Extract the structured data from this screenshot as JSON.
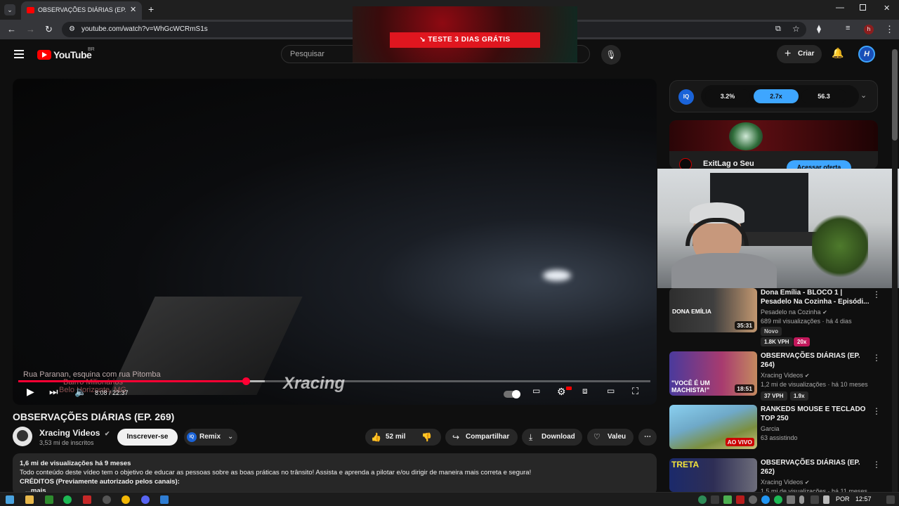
{
  "browser": {
    "tab_title": "OBSERVAÇÕES DIÁRIAS (EP. 269)",
    "tab_close": "✕",
    "new_tab": "+",
    "url": "youtube.com/watch?v=WhGcWCRmS1s",
    "profile_initial": "h"
  },
  "header": {
    "logo_text": "YouTube",
    "logo_country": "BR",
    "search_placeholder": "Pesquisar",
    "create_label": "Criar",
    "ad_cta": "↘ TESTE 3 DIAS GRÁTIS"
  },
  "player": {
    "overlay_street": "Rua Paranan, esquina com rua Pitomba",
    "overlay_neighborhood": "Bairro Milionários",
    "overlay_city": "Belo Horizonte, MG",
    "current_time": "8:08",
    "duration": "22:37",
    "time_display": "8:08 / 22:37",
    "watermark": "Xracing",
    "progress_fraction": 0.36,
    "buffered_fraction": 0.39
  },
  "video": {
    "title": "OBSERVAÇÕES DIÁRIAS (EP. 269)",
    "channel": "Xracing Videos",
    "subscribers": "3,53 mi de inscritos",
    "subscribe_label": "Inscrever-se",
    "remix_label": "Remix",
    "likes": "52 mil",
    "share_label": "Compartilhar",
    "download_label": "Download",
    "thanks_label": "Valeu",
    "views_date": "1,6 mi de visualizações  há 9 meses",
    "description": "Todo conteúdo deste vídeo tem o objetivo de educar as pessoas sobre as boas práticas no trânsito! Assista e aprenda a pilotar e/ou dirigir de maneira mais correta e segura!",
    "credits": "CRÉDITOS (Previamente autorizado pelos canais):",
    "more": "...mais"
  },
  "iq_widget": {
    "logo": "IQ",
    "values": [
      "3.2%",
      "2.7x",
      "56.3"
    ]
  },
  "sponsor": {
    "title": "ExitLag o Seu",
    "cta": "Acessar oferta"
  },
  "recommendations": [
    {
      "title": "Dona Emília  - BLOCO 1 | Pesadelo Na Cozinha - Episódi...",
      "channel": "Pesadelo na Cozinha",
      "meta": "689 mil visualizações · há 4 dias",
      "duration": "35:31",
      "badge_new": "Novo",
      "vph": "1.8K VPH",
      "mult": "20x",
      "thumb_text": "DONA EMÍLIA"
    },
    {
      "title": "OBSERVAÇÕES DIÁRIAS (EP. 264)",
      "channel": "Xracing Videos",
      "meta": "1,2 mi de visualizações · há 10 meses",
      "duration": "18:51",
      "vph": "37 VPH",
      "mult": "1.9x",
      "thumb_text": "\"VOCÊ É UM MACHISTA!\""
    },
    {
      "title": "RANKEDS MOUSE E TECLADO TOP 250",
      "channel": "Garcia",
      "meta": "63 assistindo",
      "live": "AO VIVO"
    },
    {
      "title": "OBSERVAÇÕES DIÁRIAS (EP. 262)",
      "channel": "Xracing Videos",
      "meta": "1,5 mi de visualizações · há 11 meses",
      "thumb_text": "TRETA"
    }
  ],
  "taskbar": {
    "lang": "POR",
    "clock": "12:57"
  },
  "colors": {
    "accent_red": "#ff0033",
    "iq_blue": "#3ea6ff"
  }
}
